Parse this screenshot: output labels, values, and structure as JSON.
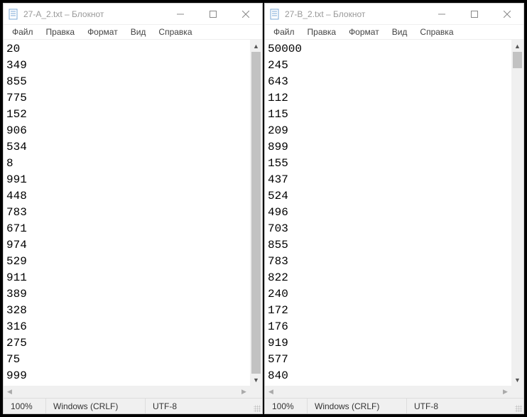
{
  "windows": [
    {
      "title": "27-A_2.txt – Блокнот",
      "menu": [
        "Файл",
        "Правка",
        "Формат",
        "Вид",
        "Справка"
      ],
      "content": "20\n349\n855\n775\n152\n906\n534\n8\n991\n448\n783\n671\n974\n529\n911\n389\n328\n316\n275\n75\n999",
      "status": {
        "zoom": "100%",
        "eol": "Windows (CRLF)",
        "encoding": "UTF-8"
      },
      "vthumb": {
        "top": "0%",
        "height": "100%"
      }
    },
    {
      "title": "27-B_2.txt – Блокнот",
      "menu": [
        "Файл",
        "Правка",
        "Формат",
        "Вид",
        "Справка"
      ],
      "content": "50000\n245\n643\n112\n115\n209\n899\n155\n437\n524\n496\n703\n855\n783\n822\n240\n172\n176\n919\n577\n840",
      "status": {
        "zoom": "100%",
        "eol": "Windows (CRLF)",
        "encoding": "UTF-8"
      },
      "vthumb": {
        "top": "0%",
        "height": "5%"
      }
    }
  ]
}
